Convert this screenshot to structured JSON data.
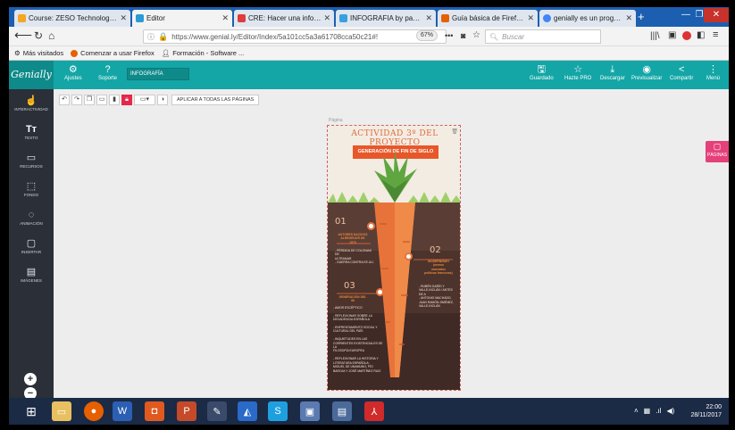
{
  "browser": {
    "tabs": [
      {
        "title": "Course: ZESO Technologies",
        "icon": "moodle-icon",
        "color": "#f5a623",
        "active": false
      },
      {
        "title": "Editor",
        "icon": "genially-icon",
        "color": "#2b9bd3",
        "active": true
      },
      {
        "title": "CRE: Hacer una infografía",
        "icon": "cre-icon",
        "color": "#e03c3c",
        "active": false
      },
      {
        "title": "INFOGRAFIA by pacusa1",
        "icon": "piktochart-icon",
        "color": "#3aa0e0",
        "active": false
      },
      {
        "title": "Guía básica de Firefox: una",
        "icon": "firefox-icon",
        "color": "#e66000",
        "active": false
      },
      {
        "title": "genially es un programa o",
        "icon": "google-icon",
        "color": "#4285f4",
        "active": false
      }
    ],
    "url": "https://www.genial.ly/Editor/Index/5a101cc5a3a61708cca50c21#!",
    "zoom": "67%",
    "search_placeholder": "Buscar",
    "bookmarks": [
      "Más visitados",
      "Comenzar a usar Firefox",
      "Formación - Software ..."
    ]
  },
  "app": {
    "logo": "Genially",
    "header_left": [
      {
        "label": "Ajustes",
        "icon": "gear-icon"
      },
      {
        "label": "Soporte",
        "icon": "help-icon"
      }
    ],
    "doc_name": "INFOGRAFÍA",
    "header_right": [
      {
        "label": "Guardado",
        "icon": "save-icon"
      },
      {
        "label": "Hazte PRO",
        "icon": "star-icon"
      },
      {
        "label": "Descargar",
        "icon": "download-icon"
      },
      {
        "label": "Previsualizar",
        "icon": "eye-icon"
      },
      {
        "label": "Compartir",
        "icon": "share-icon"
      },
      {
        "label": "Menú",
        "icon": "menu-icon"
      }
    ],
    "sidebar": [
      {
        "label": "INTERACTIVIDAD",
        "icon": "interactivity-icon"
      },
      {
        "label": "TEXTO",
        "icon": "text-icon"
      },
      {
        "label": "RECURSOS",
        "icon": "resources-icon"
      },
      {
        "label": "FONDO",
        "icon": "background-icon"
      },
      {
        "label": "ANIMACIÓN",
        "icon": "animation-icon"
      },
      {
        "label": "INSERTAR",
        "icon": "insert-icon"
      },
      {
        "label": "IMÁGENES",
        "icon": "images-icon"
      }
    ],
    "toolbar_apply_all": "APLICAR A TODAS LAS PÁGINAS",
    "page_label": "Página",
    "pages_button": "PÁGINAS"
  },
  "poster": {
    "title": "ACTIVIDAD 3º DEL PROYECTO",
    "banner": "GENERACIÓN DE FIN DE SIGLO",
    "sections": [
      {
        "number": "01",
        "heading": "AUTORES NACIDOS\nALREDEDOR DE\n1870",
        "body": "- PÉRDIDA DE COLONIAS DE\nULTRAMAR\n- GUERRA CONTRA EE.UU."
      },
      {
        "number": "02",
        "heading": "MODERNISMO\n(menos\nmarcados\npolíticas francesas)",
        "body": "- RUBÉN DARÍO Y\nVALLE-INCLÁN / ANTES\nDE A\n- ANTONIO MACHADO,\nJUAN RAMÓN JIMÉNEZ,\nVALLE-INCLÁN"
      },
      {
        "number": "03",
        "heading": "GENERACIÓN DEL\n98",
        "body": "- AMOR ESCÉPTICO\n\n- REFLEXIONAR SOBRE LA\nDECADENCIA ESPAÑOLA\n\n- ENFRENTAMIENTO SOCIAL Y\nCULTURAL DEL PAÍS\n\n- INQUIETUDES EN LAS\nCORRIENTES EXISTENCIALES DE LA\nFILOSOFÍA EUROPEA\n\n- REFLEXIONAR LA HISTORIA Y\nLITERATURA ESPAÑOLA:\nMIGUEL DE UNAMUNO, PÍO\nBAROJA Y JOSÉ MARTÍNEZ RUIZ"
      }
    ]
  },
  "taskbar": {
    "clock_time": "22:00",
    "clock_date": "28/11/2017"
  }
}
